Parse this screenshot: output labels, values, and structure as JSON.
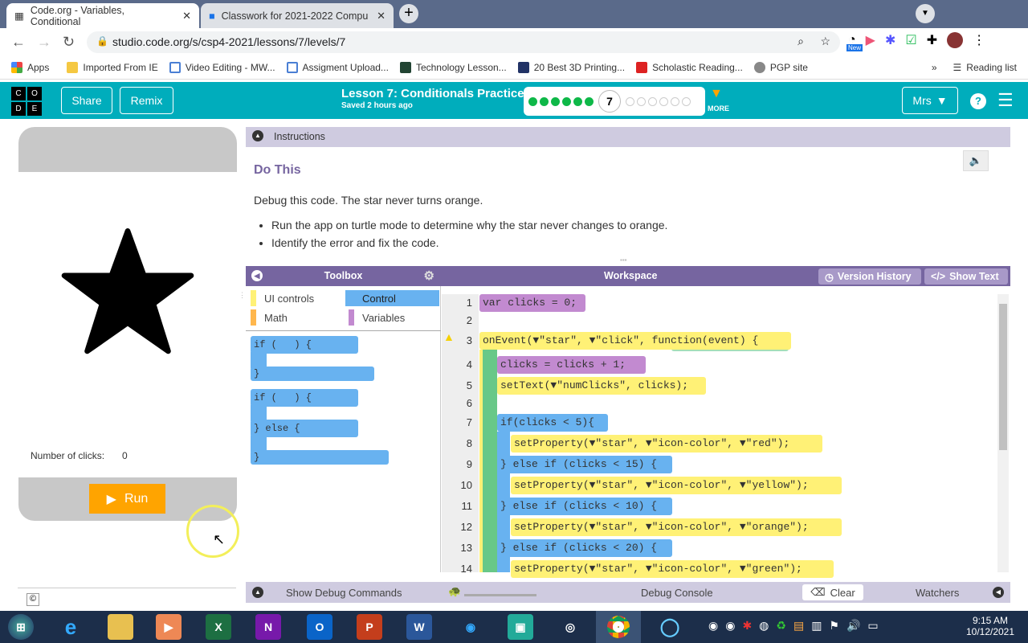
{
  "browser": {
    "tabs": [
      {
        "title": "Code.org - Variables, Conditional"
      },
      {
        "title": "Classwork for 2021-2022 Compu"
      }
    ],
    "url": "studio.code.org/s/csp4-2021/lessons/7/levels/7",
    "bookmarks": [
      "Apps",
      "Imported From IE",
      "Video Editing - MW...",
      "Assigment Upload...",
      "Technology Lesson...",
      "20 Best 3D Printing...",
      "Scholastic Reading...",
      "PGP site"
    ],
    "reading_list": "Reading list",
    "new_badge": "New"
  },
  "header": {
    "logo": [
      "C",
      "O",
      "D",
      "E"
    ],
    "share": "Share",
    "remix": "Remix",
    "title": "Lesson 7: Conditionals Practice",
    "saved": "Saved 2 hours ago",
    "current_level": "7",
    "completed_levels": 6,
    "remaining_levels": 6,
    "more": "MORE",
    "user": "Mrs"
  },
  "app": {
    "clicks_label": "Number of clicks:",
    "clicks_value": "0",
    "run": "Run"
  },
  "instructions": {
    "header": "Instructions",
    "title": "Do This",
    "text": "Debug this code. The star never turns orange.",
    "bullets": [
      "Run the app on turtle mode to determine why the star never changes to orange.",
      "Identify the error and fix the code."
    ]
  },
  "toolbox": {
    "title": "Toolbox",
    "categories": [
      "UI controls",
      "Control",
      "Math",
      "Variables"
    ],
    "blocks": [
      "if (   ) {",
      "}",
      "if (   ) {",
      "} else {",
      "}"
    ]
  },
  "workspace": {
    "title": "Workspace",
    "version_history": "Version History",
    "show_text": "Show Text",
    "lines": [
      "var clicks = 0;",
      "",
      "onEvent(▼\"star\", ▼\"click\", function(event) {",
      "clicks = clicks + 1;",
      "setText(▼\"numClicks\", clicks);",
      "",
      "if(clicks < 5){",
      "setProperty(▼\"star\", ▼\"icon-color\", ▼\"red\");",
      "} else if (clicks < 15) {",
      "setProperty(▼\"star\", ▼\"icon-color\", ▼\"yellow\");",
      "} else if (clicks < 10) {",
      "setProperty(▼\"star\", ▼\"icon-color\", ▼\"orange\");",
      "} else if (clicks < 20) {",
      "setProperty(▼\"star\", ▼\"icon-color\", ▼\"green\");"
    ],
    "line_numbers": [
      "1",
      "2",
      "3",
      "4",
      "5",
      "6",
      "7",
      "8",
      "9",
      "10",
      "11",
      "12",
      "13",
      "14"
    ]
  },
  "debug": {
    "show": "Show Debug Commands",
    "console": "Debug Console",
    "clear": "Clear",
    "watchers": "Watchers"
  },
  "taskbar": {
    "time": "9:15 AM",
    "date": "10/12/2021"
  }
}
